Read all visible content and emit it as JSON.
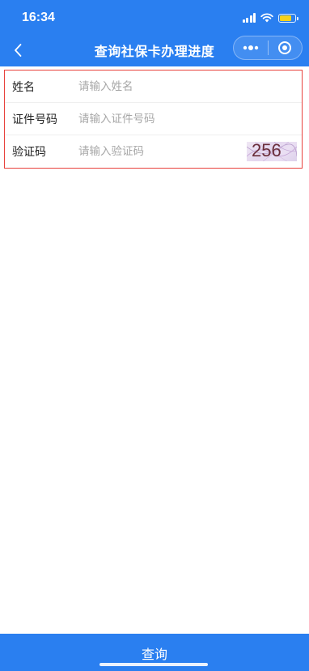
{
  "status_bar": {
    "time": "16:34",
    "battery_level": 0.85,
    "battery_color": "#f6d21b"
  },
  "nav": {
    "title": "查询社保卡办理进度",
    "back_icon": "chevron-left-icon",
    "more_icon": "more-dots-icon",
    "close_icon": "target-circle-icon"
  },
  "form": {
    "rows": [
      {
        "label": "姓名",
        "placeholder": "请输入姓名",
        "value": ""
      },
      {
        "label": "证件号码",
        "placeholder": "请输入证件号码",
        "value": ""
      },
      {
        "label": "验证码",
        "placeholder": "请输入验证码",
        "value": ""
      }
    ],
    "captcha_text": "256"
  },
  "submit": {
    "label": "查询"
  },
  "colors": {
    "primary": "#2a7ff0",
    "highlight_border": "#e8413c"
  }
}
